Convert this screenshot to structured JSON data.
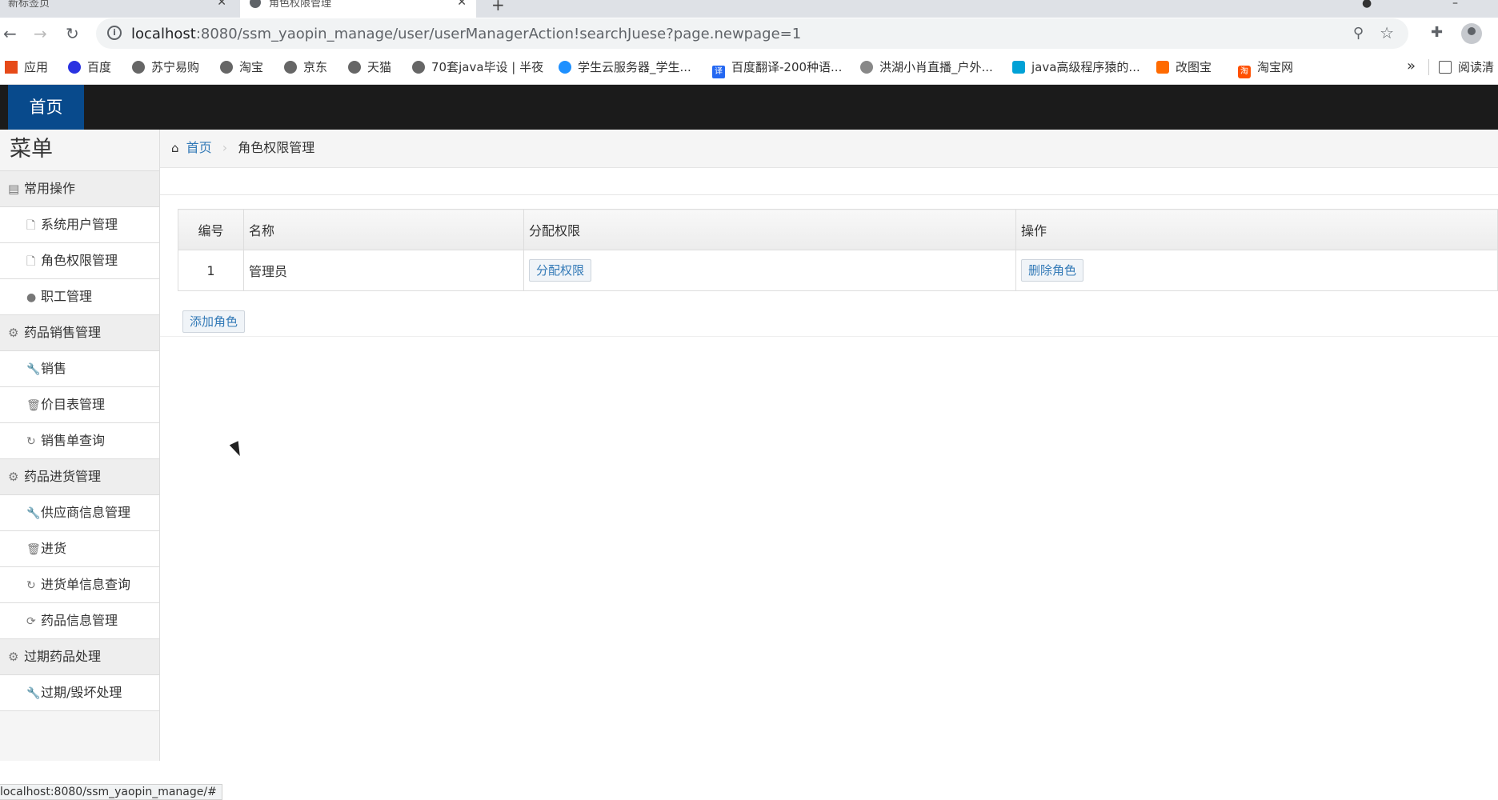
{
  "browser": {
    "tab_inactive": "新标签页",
    "tab_active": "角色权限管理",
    "url_host": "localhost",
    "url_path": ":8080/ssm_yaopin_manage/user/userManagerAction!searchJuese?page.newpage=1",
    "bookmarks": [
      "应用",
      "百度",
      "苏宁易购",
      "淘宝",
      "京东",
      "天猫",
      "70套java毕设 | 半夜",
      "学生云服务器_学生...",
      "百度翻译-200种语...",
      "洪湖小肖直播_户外...",
      "java高级程序猿的...",
      "改图宝",
      "淘宝网"
    ],
    "reading_list": "阅读清",
    "status_url": "localhost:8080/ssm_yaopin_manage/#"
  },
  "header": {
    "home_label": "首页"
  },
  "sidebar": {
    "title": "菜单",
    "groups": [
      {
        "label": "常用操作",
        "items": [
          "系统用户管理",
          "角色权限管理",
          "职工管理"
        ]
      },
      {
        "label": "药品销售管理",
        "items": [
          "销售",
          "价目表管理",
          "销售单查询"
        ]
      },
      {
        "label": "药品进货管理",
        "items": [
          "供应商信息管理",
          "进货",
          "进货单信息查询",
          "药品信息管理"
        ]
      },
      {
        "label": "过期药品处理",
        "items": [
          "过期/毁坏处理"
        ]
      }
    ]
  },
  "breadcrumb": {
    "home": "首页",
    "current": "角色权限管理"
  },
  "table": {
    "headers": [
      "编号",
      "名称",
      "分配权限",
      "操作"
    ],
    "rows": [
      {
        "id": "1",
        "name": "管理员",
        "assign": "分配权限",
        "action": "删除角色"
      }
    ]
  },
  "add_role_label": "添加角色"
}
